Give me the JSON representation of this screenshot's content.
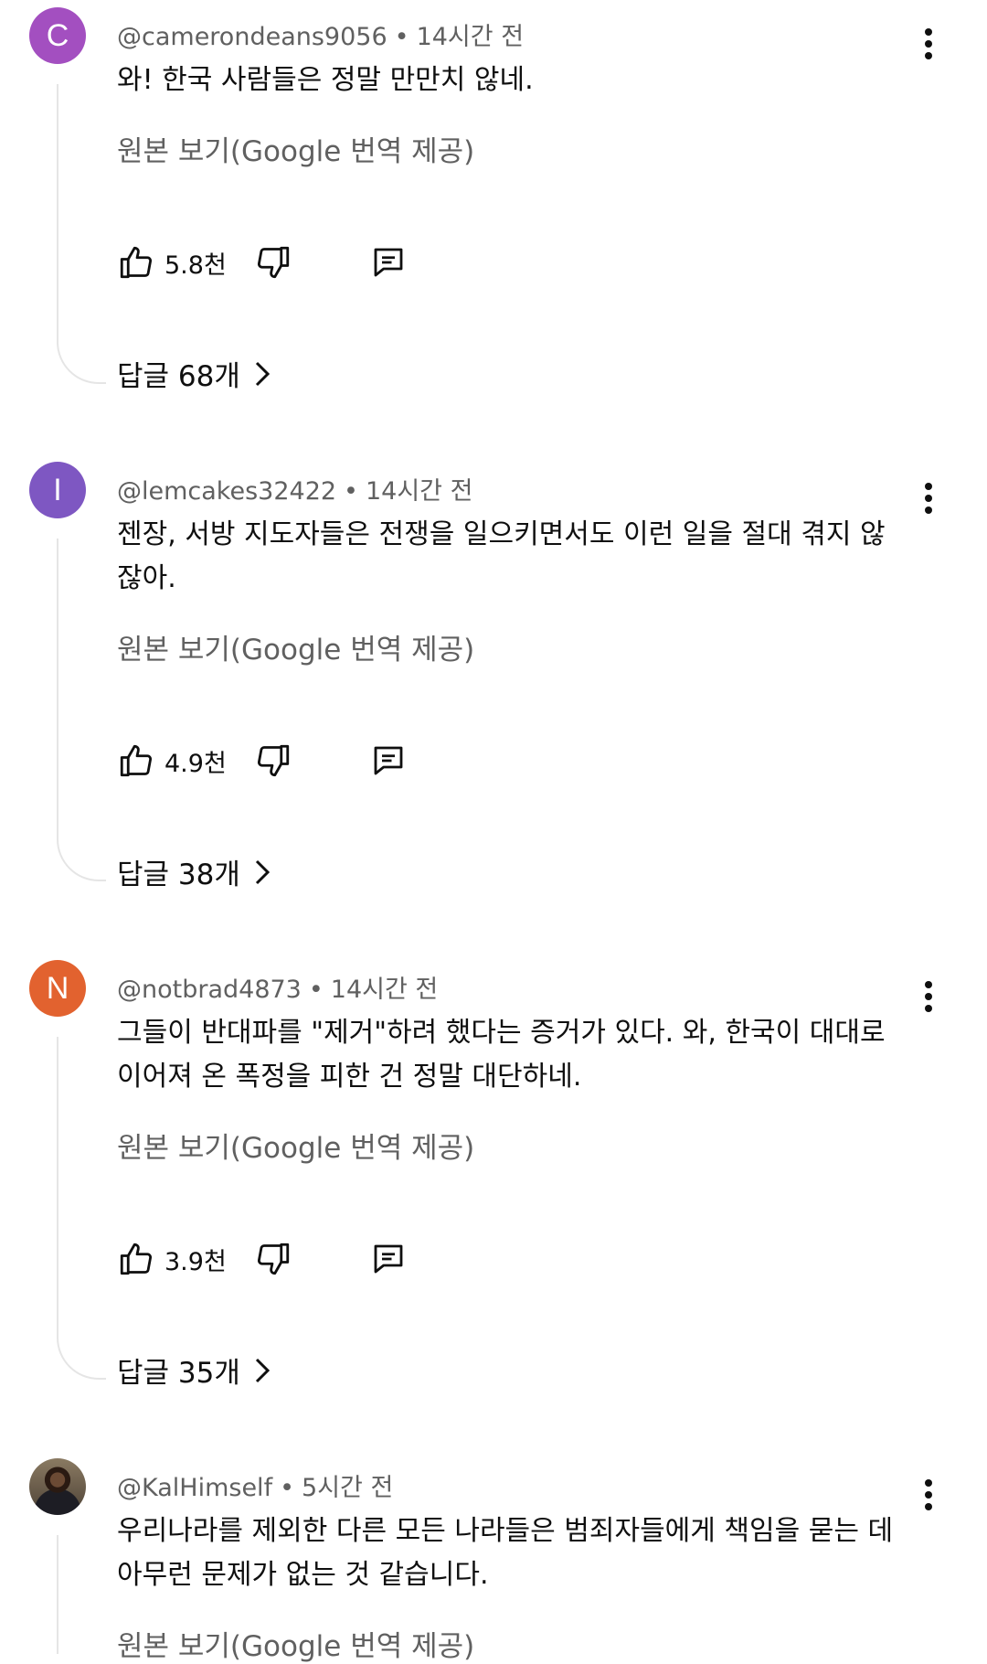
{
  "comments": [
    {
      "avatar_letter": "C",
      "avatar_color": "#a34fc0",
      "username": "@camerondeans9056",
      "time": "14시간 전",
      "text": "와! 한국 사람들은 정말 만만치 않네.",
      "translate_label": "원본 보기(Google 번역 제공)",
      "likes": "5.8천",
      "replies_label": "답글 68개"
    },
    {
      "avatar_letter": "I",
      "avatar_color": "#7e57c2",
      "username": "@lemcakes32422",
      "time": "14시간 전",
      "text": "젠장, 서방 지도자들은 전쟁을 일으키면서도 이런 일을 절대 겪지 않잖아.",
      "translate_label": "원본 보기(Google 번역 제공)",
      "likes": "4.9천",
      "replies_label": "답글 38개"
    },
    {
      "avatar_letter": "N",
      "avatar_color": "#e2622f",
      "username": "@notbrad4873",
      "time": "14시간 전",
      "text": "그들이 반대파를 \"제거\"하려 했다는 증거가 있다. 와, 한국이 대대로 이어져 온 폭정을 피한 건 정말 대단하네.",
      "translate_label": "원본 보기(Google 번역 제공)",
      "likes": "3.9천",
      "replies_label": "답글 35개"
    },
    {
      "avatar_letter": "",
      "avatar_color": "#4d4236",
      "username": "@KalHimself",
      "time": "5시간 전",
      "text": "우리나라를 제외한 다른 모든 나라들은 범죄자들에게 책임을 묻는 데 아무런 문제가 없는 것 같습니다.",
      "translate_label": "원본 보기(Google 번역 제공)"
    }
  ],
  "separator": "•",
  "icons": {
    "like": "thumb-up-icon",
    "dislike": "thumb-down-icon",
    "reply": "comment-icon",
    "more": "more-vertical-icon",
    "replies_arrow": "chevron-right-icon"
  }
}
